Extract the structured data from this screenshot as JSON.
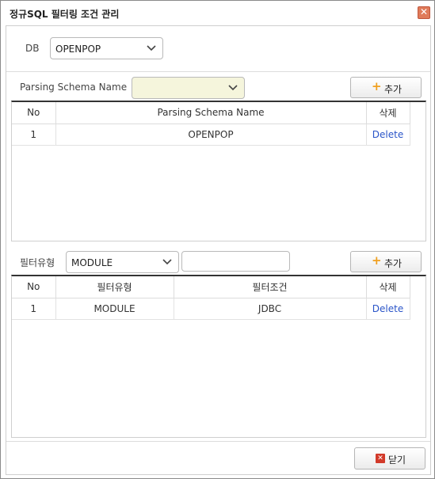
{
  "window": {
    "title": "정규SQL 필터링 조건 관리",
    "close_glyph": "✕"
  },
  "db": {
    "label": "DB",
    "selected": "OPENPOP"
  },
  "schema": {
    "label": "Parsing Schema Name",
    "selected": "",
    "add_label": "추가",
    "columns": [
      "No",
      "Parsing Schema Name",
      "삭제"
    ],
    "rows": [
      {
        "no": "1",
        "name": "OPENPOP",
        "action": "Delete"
      }
    ]
  },
  "filter": {
    "label": "필터유형",
    "selected": "MODULE",
    "condition_value": "",
    "add_label": "추가",
    "columns": [
      "No",
      "필터유형",
      "필터조건",
      "삭제"
    ],
    "rows": [
      {
        "no": "1",
        "type": "MODULE",
        "condition": "JDBC",
        "action": "Delete"
      }
    ]
  },
  "footer": {
    "close_label": "닫기"
  },
  "colors": {
    "plus": "#f0a020",
    "delete_link": "#2a54c8",
    "close_icon": "#d23a2a",
    "schema_select_bg": "#f5f5dc"
  },
  "icons": {
    "add": "plus-icon",
    "dropdown": "chevron-down-icon",
    "close_dialog": "close-icon"
  }
}
